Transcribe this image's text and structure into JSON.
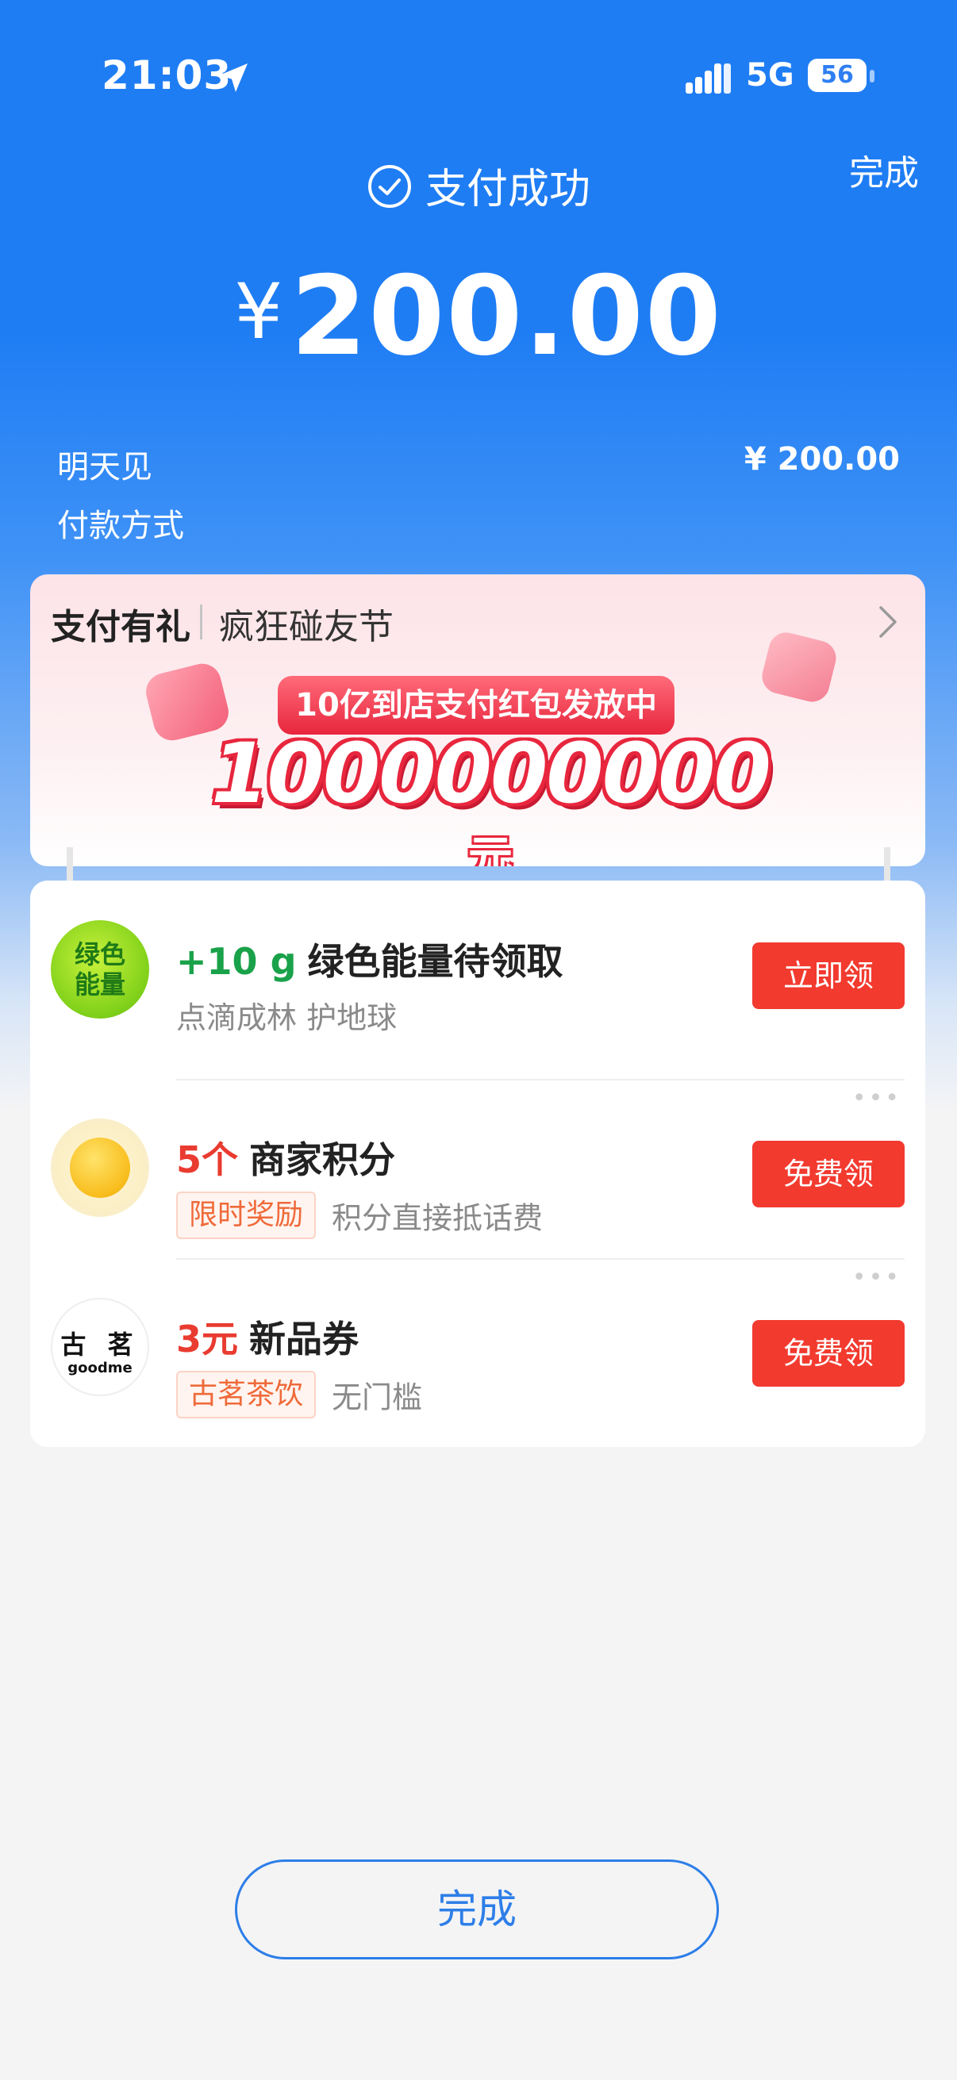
{
  "status_bar": {
    "time": "21:03",
    "network": "5G",
    "battery": "56"
  },
  "header": {
    "done_label": "完成",
    "title": "支付成功",
    "currency": "¥",
    "amount": "200.00"
  },
  "details": {
    "merchant_label": "明天见",
    "merchant_amount": "¥ 200.00",
    "payment_method_label": "付款方式"
  },
  "promo": {
    "title": "支付有礼",
    "subtitle": "疯狂碰友节",
    "pill": "10亿到店支付红包发放中",
    "big_number": "1000000000",
    "big_unit": "元"
  },
  "rewards": [
    {
      "prefix": "+10 g",
      "title": "绿色能量待领取",
      "tag": "",
      "subtitle": "点滴成林 护地球",
      "button": "立即领",
      "icon": "green-energy-icon",
      "avatar_text": "绿色能量"
    },
    {
      "prefix": "5个",
      "title": "商家积分",
      "tag": "限时奖励",
      "subtitle": "积分直接抵话费",
      "button": "免费领",
      "icon": "gold-coin-icon"
    },
    {
      "prefix": "3元",
      "title": "新品券",
      "tag": "古茗茶饮",
      "subtitle": "无门槛",
      "button": "免费领",
      "icon": "goodme-logo",
      "avatar_cn": "古 茗",
      "avatar_en": "goodme"
    }
  ],
  "footer": {
    "done_label": "完成"
  },
  "colors": {
    "primary_blue": "#1f7df4",
    "cta_red": "#f23a2f",
    "energy_green": "#1aa24a",
    "value_red": "#e93b30"
  }
}
